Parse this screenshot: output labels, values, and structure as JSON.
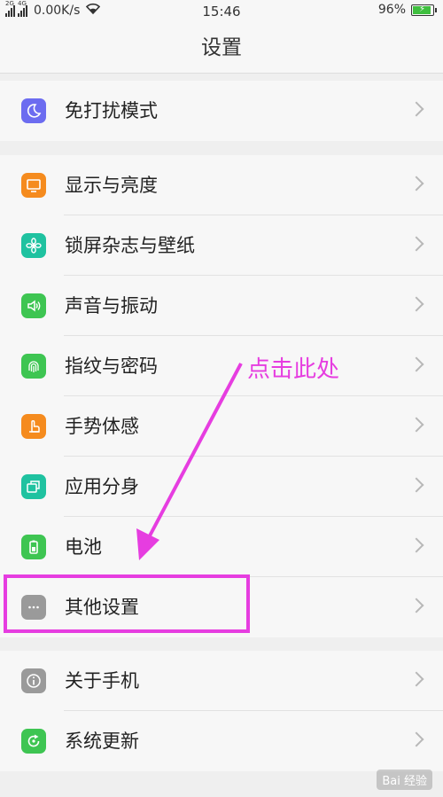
{
  "status_bar": {
    "signal1_tag": "2G",
    "signal2_tag": "4G",
    "speed": "0.00K/s",
    "time": "15:46",
    "battery": "96%",
    "battery_level": 0.96
  },
  "title": "设置",
  "groups": [
    {
      "items": [
        {
          "label": "免打扰模式",
          "icon": "moon-icon",
          "color": "#6c6cf0"
        }
      ]
    },
    {
      "items": [
        {
          "label": "显示与亮度",
          "icon": "display-icon",
          "color": "#f58b1e"
        },
        {
          "label": "锁屏杂志与壁纸",
          "icon": "flower-icon",
          "color": "#1fc2a0"
        },
        {
          "label": "声音与振动",
          "icon": "speaker-icon",
          "color": "#3ec552"
        },
        {
          "label": "指纹与密码",
          "icon": "fingerprint-icon",
          "color": "#3ec552"
        },
        {
          "label": "手势体感",
          "icon": "hand-icon",
          "color": "#f58b1e"
        },
        {
          "label": "应用分身",
          "icon": "clone-icon",
          "color": "#1fc2a0"
        },
        {
          "label": "电池",
          "icon": "battery-icon",
          "color": "#3ec552"
        },
        {
          "label": "其他设置",
          "icon": "more-icon",
          "color": "#9a9a9a"
        }
      ]
    },
    {
      "items": [
        {
          "label": "关于手机",
          "icon": "info-icon",
          "color": "#9a9a9a"
        },
        {
          "label": "系统更新",
          "icon": "update-icon",
          "color": "#3ec552"
        }
      ]
    }
  ],
  "annotation": {
    "text": "点击此处",
    "color": "#e63de0"
  },
  "watermark": "Bai 经验"
}
